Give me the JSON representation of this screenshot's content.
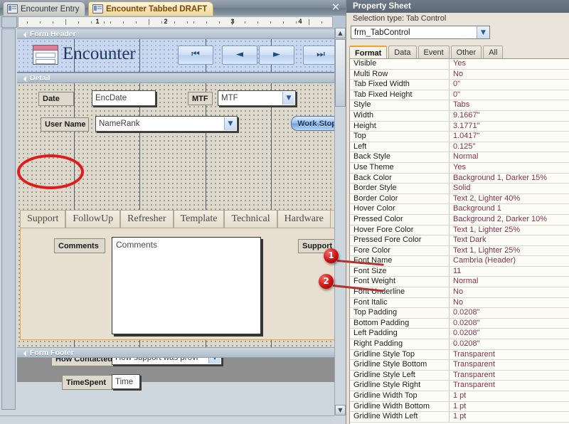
{
  "document_tabs": [
    {
      "label": "Encounter Entry",
      "active": false
    },
    {
      "label": "Encounter Tabbed DRAFT",
      "active": true
    }
  ],
  "close_icon": "✕",
  "ruler": {
    "numbers": [
      "1",
      "2",
      "3",
      "4"
    ]
  },
  "form": {
    "sections": {
      "header": "Form Header",
      "detail": "Detail",
      "footer": "Form Footer"
    },
    "header": {
      "title": "Encounter",
      "nav_buttons": [
        {
          "name": "first-record",
          "glyph": "⏮"
        },
        {
          "name": "previous-record",
          "glyph": "◄"
        },
        {
          "name": "next-record",
          "glyph": "►"
        },
        {
          "name": "last-record",
          "glyph": "⏭"
        }
      ]
    },
    "detail": {
      "date_label": "Date",
      "date_value": "EncDate",
      "mtf_label": "MTF",
      "mtf_value": "MTF",
      "username_label": "User Name",
      "username_value": "NameRank",
      "work_stopped_label": "Work Stopp",
      "comments_label": "Comments",
      "comments_value": "Comments",
      "support_type_label": "Support T",
      "how_contacted_label": "How Contacted",
      "how_contacted_value": "How support was provi",
      "timespent_label": "TimeSpent",
      "timespent_value": "Time"
    },
    "tab_control": {
      "tabs": [
        "Support",
        "FollowUp",
        "Refresher",
        "Template",
        "Technical",
        "Hardware"
      ],
      "selected": "Support"
    }
  },
  "property_sheet": {
    "title": "Property Sheet",
    "selection_type": "Selection type:  Tab Control",
    "object": "frm_TabControl",
    "tabs": [
      {
        "label": "Format",
        "selected": true
      },
      {
        "label": "Data",
        "selected": false
      },
      {
        "label": "Event",
        "selected": false
      },
      {
        "label": "Other",
        "selected": false
      },
      {
        "label": "All",
        "selected": false
      }
    ],
    "rows": [
      {
        "name": "Visible",
        "value": "Yes"
      },
      {
        "name": "Multi Row",
        "value": "No"
      },
      {
        "name": "Tab Fixed Width",
        "value": "0\""
      },
      {
        "name": "Tab Fixed Height",
        "value": "0\""
      },
      {
        "name": "Style",
        "value": "Tabs"
      },
      {
        "name": "Width",
        "value": "9.1667\""
      },
      {
        "name": "Height",
        "value": "3.1771\""
      },
      {
        "name": "Top",
        "value": "1.0417\""
      },
      {
        "name": "Left",
        "value": "0.125\""
      },
      {
        "name": "Back Style",
        "value": "Normal"
      },
      {
        "name": "Use Theme",
        "value": "Yes"
      },
      {
        "name": "Back Color",
        "value": "Background 1, Darker 15%"
      },
      {
        "name": "Border Style",
        "value": "Solid"
      },
      {
        "name": "Border Color",
        "value": "Text 2, Lighter 40%"
      },
      {
        "name": "Hover Color",
        "value": "Background 1"
      },
      {
        "name": "Pressed Color",
        "value": "Background 2, Darker 10%"
      },
      {
        "name": "Hover Fore Color",
        "value": "Text 1, Lighter 25%"
      },
      {
        "name": "Pressed Fore Color",
        "value": "Text Dark"
      },
      {
        "name": "Fore Color",
        "value": "Text 1, Lighter 25%"
      },
      {
        "name": "Font Name",
        "value": "Cambria (Header)"
      },
      {
        "name": "Font Size",
        "value": "11"
      },
      {
        "name": "Font Weight",
        "value": "Normal"
      },
      {
        "name": "Font Underline",
        "value": "No"
      },
      {
        "name": "Font Italic",
        "value": "No"
      },
      {
        "name": "Top Padding",
        "value": "0.0208\""
      },
      {
        "name": "Bottom Padding",
        "value": "0.0208\""
      },
      {
        "name": "Left Padding",
        "value": "0.0208\""
      },
      {
        "name": "Right Padding",
        "value": "0.0208\""
      },
      {
        "name": "Gridline Style Top",
        "value": "Transparent"
      },
      {
        "name": "Gridline Style Bottom",
        "value": "Transparent"
      },
      {
        "name": "Gridline Style Left",
        "value": "Transparent"
      },
      {
        "name": "Gridline Style Right",
        "value": "Transparent"
      },
      {
        "name": "Gridline Width Top",
        "value": "1 pt"
      },
      {
        "name": "Gridline Width Bottom",
        "value": "1 pt"
      },
      {
        "name": "Gridline Width Left",
        "value": "1 pt"
      }
    ]
  },
  "annotations": {
    "callouts": [
      {
        "number": "1",
        "target": "Font Name"
      },
      {
        "number": "2",
        "target": "Font Weight"
      }
    ],
    "highlight_target": "Support"
  },
  "scroll": {
    "up_glyph": "▲",
    "down_glyph": "▼"
  },
  "colors": {
    "accent_orange": "#e8a33d",
    "annotation_red": "#d01010",
    "value_text": "#8a2f4b"
  }
}
